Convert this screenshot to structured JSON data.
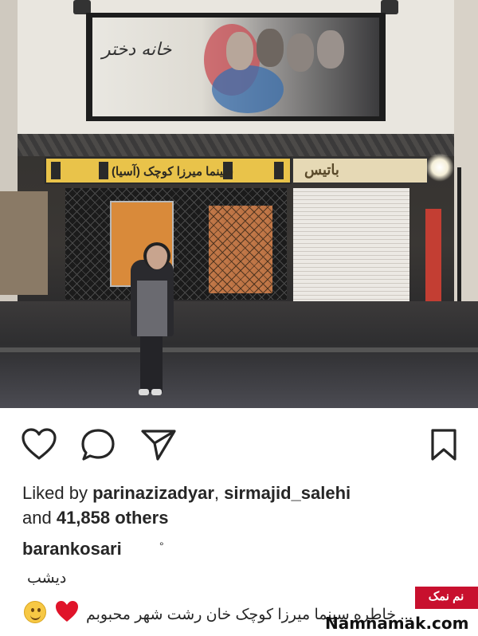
{
  "photo": {
    "poster_title": "خانه دختر",
    "cinema_sign": "سینما میرزا کوچک (آسیا)",
    "shop_sign": "باتیس"
  },
  "actions": {
    "like_icon": "heart-outline-icon",
    "comment_icon": "comment-bubble-icon",
    "share_icon": "paper-plane-icon",
    "save_icon": "bookmark-icon"
  },
  "likes": {
    "prefix": "Liked by ",
    "user1": "parinazizadyar",
    "separator": ", ",
    "user2": "sirmajid_salehi",
    "and": "and ",
    "count": "41,858 others"
  },
  "post": {
    "username": "barankosari",
    "verified_mark": "°",
    "caption_line1": "دیشب",
    "caption_line2": "... خاطره سینما میرزا کوچک خان رشت شهر محبوبم",
    "emoji": [
      "smiling-face-icon",
      "red-heart-icon"
    ]
  },
  "watermark": {
    "tag": "نم نمک",
    "site": "Namnamak.com",
    "tag_color": "#c8102e"
  }
}
